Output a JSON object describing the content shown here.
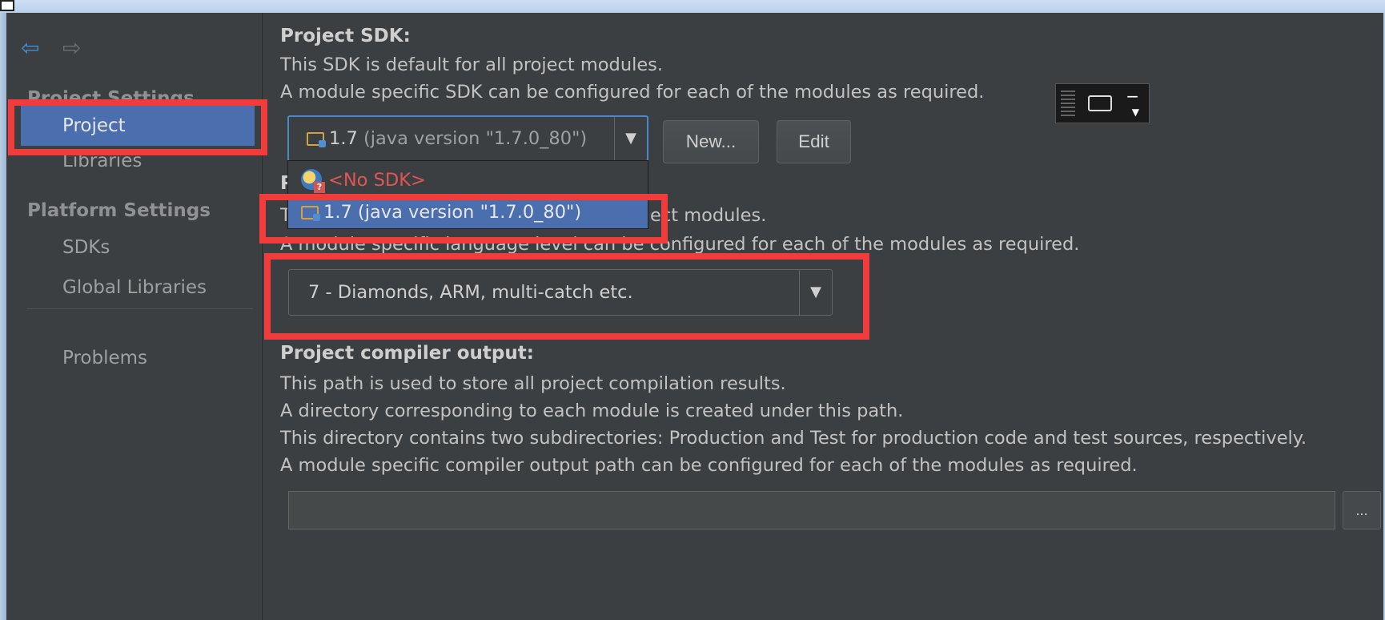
{
  "sidebar": {
    "project_settings_title": "Project Settings",
    "platform_settings_title": "Platform Settings",
    "items": [
      {
        "label": "Project"
      },
      {
        "label": "Libraries"
      },
      {
        "label": "SDKs"
      },
      {
        "label": "Global Libraries"
      },
      {
        "label": "Problems"
      }
    ],
    "back_icon": "arrow-left-icon",
    "forward_icon": "arrow-right-icon"
  },
  "sdk": {
    "heading": "Project SDK:",
    "desc1": "This SDK is default for all project modules.",
    "desc2": "A module specific SDK can be configured for each of the modules as required.",
    "selected_version": "1.7",
    "selected_detail": "(java version \"1.7.0_80\")",
    "new_button": "New...",
    "edit_button": "Edit",
    "dropdown_options": [
      {
        "label": "<No SDK>",
        "icon": "no-sdk-icon"
      },
      {
        "label": "1.7 (java version \"1.7.0_80\")",
        "icon": "folder-jdk-icon"
      }
    ]
  },
  "language_level": {
    "heading_partial": "P",
    "desc1_partial": "T",
    "desc1_visible": "ect modules.",
    "desc2": "A module specific language level can be configured for each of the modules as required.",
    "selected": "7 - Diamonds, ARM, multi-catch etc."
  },
  "compiler_output": {
    "heading": "Project compiler output:",
    "desc1": "This path is used to store all project compilation results.",
    "desc2": "A directory corresponding to each module is created under this path.",
    "desc3": "This directory contains two subdirectories: Production and Test for production code and test sources, respectively.",
    "desc4": "A module specific compiler output path can be configured for each of the modules as required.",
    "path_value": "",
    "browse_label": "..."
  },
  "colors": {
    "highlight": "#f23b3b",
    "selection": "#4b6eaf",
    "background": "#3c3f41"
  }
}
